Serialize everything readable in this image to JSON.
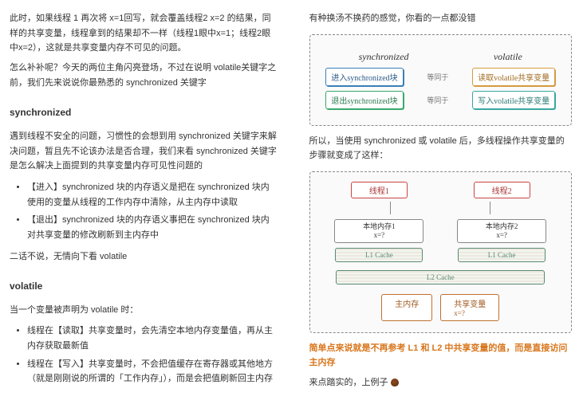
{
  "left": {
    "p1": "此时，如果线程 1 再次将 x=1回写，就会覆盖线程2 x=2 的结果，同样的共享变量，线程拿到的结果却不一样（线程1眼中x=1；线程2眼中x=2），这就是共享变量内存不可见的问题。",
    "p2": "怎么补补呢？今天的两位主角闪亮登场，不过在说明 volatile关键字之前，我们先来说说你最熟悉的 synchronized 关键字",
    "h1": "synchronized",
    "p3": "遇到线程不安全的问题，习惯性的会想到用 synchronized 关键字来解决问题，暂且先不论该办法是否合理，我们来看 synchronized 关键字是怎么解决上面提到的共享变量内存可见性问题的",
    "li1": "【进入】synchronized 块的内存语义是把在 synchronized 块内使用的变量从线程的工作内存中清除，从主内存中读取",
    "li2": "【退出】synchronized 块的内存语义事把在 synchronized 块内对共享变量的修改刷新到主内存中",
    "p4": "二话不说，无情向下看 volatile",
    "h2": "volatile",
    "p5": "当一个变量被声明为 volatile 时：",
    "li3": "线程在【读取】共享变量时，会先清空本地内存变量值，再从主内存获取最新值",
    "li4": "线程在【写入】共享变量时，不会把值缓存在寄存器或其他地方（就是刚刚说的所谓的「工作内存」），而是会把值刷新回主内存"
  },
  "right": {
    "p1": "有种换汤不换药的感觉，你看的一点都没错",
    "d1": {
      "colA": "synchronized",
      "colB": "volatile",
      "r1a": "进入synchronized块",
      "arrow": "等同于",
      "r1b": "读取volatile共享变量",
      "r2a": "退出synchronized块",
      "r2b": "写入volatile共享变量"
    },
    "p2": "所以，当使用 synchronized 或 volatile 后，多线程操作共享变量的步骤就变成了这样：",
    "d2": {
      "t1": "线程1",
      "t2": "线程2",
      "w1": "本地内存1",
      "w1v": "x=?",
      "w2": "本地内存2",
      "w2v": "x=?",
      "l1": "L1 Cache",
      "l2": "L2 Cache",
      "main": "主内存",
      "shared": "共享变量",
      "sharedv": "x=?"
    },
    "p3": "简单点来说就是不再参考 L1 和 L2 中共享变量的值，而是直接访问主内存",
    "p4": "来点踏实的，上例子"
  }
}
